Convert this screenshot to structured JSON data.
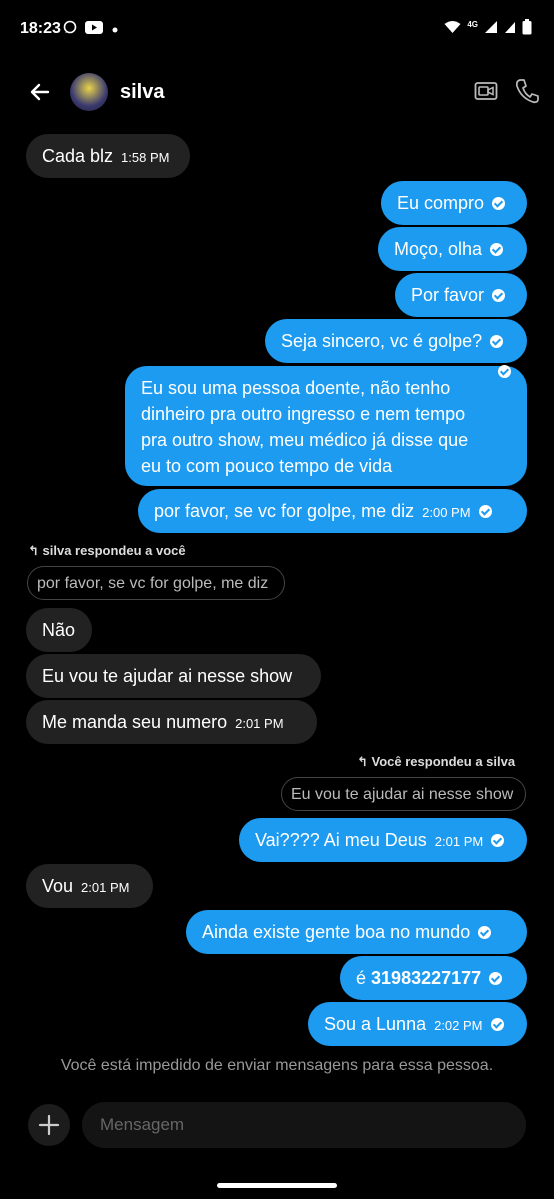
{
  "status_bar": {
    "time": "18:23",
    "network": "4G"
  },
  "header": {
    "contact_name": "silva"
  },
  "messages": {
    "m1": {
      "text": "Cada blz",
      "time": "1:58 PM"
    },
    "m2": {
      "text": "Eu compro"
    },
    "m3": {
      "text": "Moço, olha"
    },
    "m4": {
      "text": "Por favor"
    },
    "m5": {
      "text": "Seja sincero, vc é golpe?"
    },
    "m6": {
      "lines": [
        "Eu sou uma pessoa doente, não tenho",
        "dinheiro pra outro ingresso e nem tempo",
        "pra outro show, meu médico já disse que",
        "eu to com pouco tempo de vida"
      ]
    },
    "m7": {
      "text": "por favor, se vc for golpe, me diz",
      "time": "2:00 PM"
    },
    "reply1": {
      "label": "silva respondeu a você",
      "quote": "por favor, se vc for golpe, me diz"
    },
    "m8": {
      "text": "Não"
    },
    "m9": {
      "text": "Eu vou te ajudar ai nesse show"
    },
    "m10": {
      "text": "Me manda seu numero",
      "time": "2:01 PM"
    },
    "reply2": {
      "label": "Você respondeu a silva",
      "quote": "Eu vou te ajudar ai nesse show"
    },
    "m11": {
      "text": "Vai???? Ai meu Deus",
      "time": "2:01 PM"
    },
    "m12": {
      "text": "Vou",
      "time": "2:01 PM"
    },
    "m13": {
      "text": "Ainda existe gente boa no mundo"
    },
    "m14": {
      "prefix": "é",
      "number": "31983227177"
    },
    "m15": {
      "text": "Sou a Lunna",
      "time": "2:02 PM"
    }
  },
  "blocked_notice": "Você está impedido de enviar mensagens para essa pessoa.",
  "composer": {
    "placeholder": "Mensagem"
  },
  "colors": {
    "outgoing": "#1d9bf0",
    "incoming": "#222222",
    "background": "#000000"
  },
  "icons": [
    "whatsapp-icon",
    "youtube-icon",
    "wifi-icon",
    "signal-icon",
    "battery-icon",
    "back-arrow-icon",
    "video-call-icon",
    "phone-call-icon",
    "read-check-icon",
    "reply-arrow-icon",
    "plus-icon"
  ]
}
